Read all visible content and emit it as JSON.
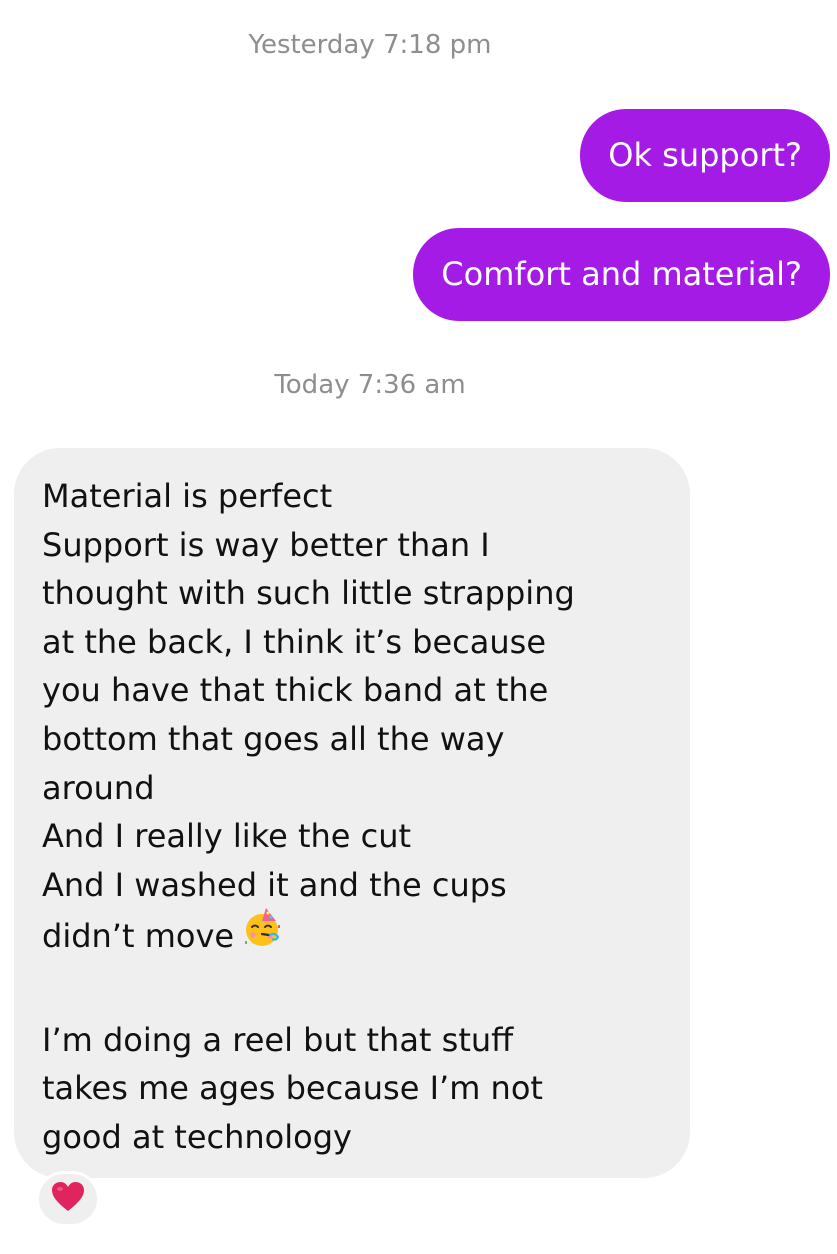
{
  "conversation": {
    "timestamps": [
      "Yesterday 7:18 pm",
      "Today 7:36 am"
    ],
    "sent_messages": [
      "Ok support?",
      "Comfort and material?"
    ],
    "received_message": {
      "lines": [
        "Material is perfect",
        "Support is way better than I",
        "thought with such little strapping",
        "at the back, I think it’s because",
        "you have that thick band at the",
        "bottom that goes all the way",
        "around",
        "And I really like the cut",
        "And I washed it and the cups",
        "didn’t move",
        "",
        "I’m doing a reel but that stuff",
        "takes me ages because I’m not",
        "good at technology"
      ],
      "inline_emoji": "partying-face-icon",
      "reaction": "red-heart-icon"
    }
  },
  "colors": {
    "sent_bubble": "#a51be6",
    "received_bubble": "#efefef",
    "timestamp_text": "#8e8e8e",
    "reaction_heart": "#e0245e"
  }
}
